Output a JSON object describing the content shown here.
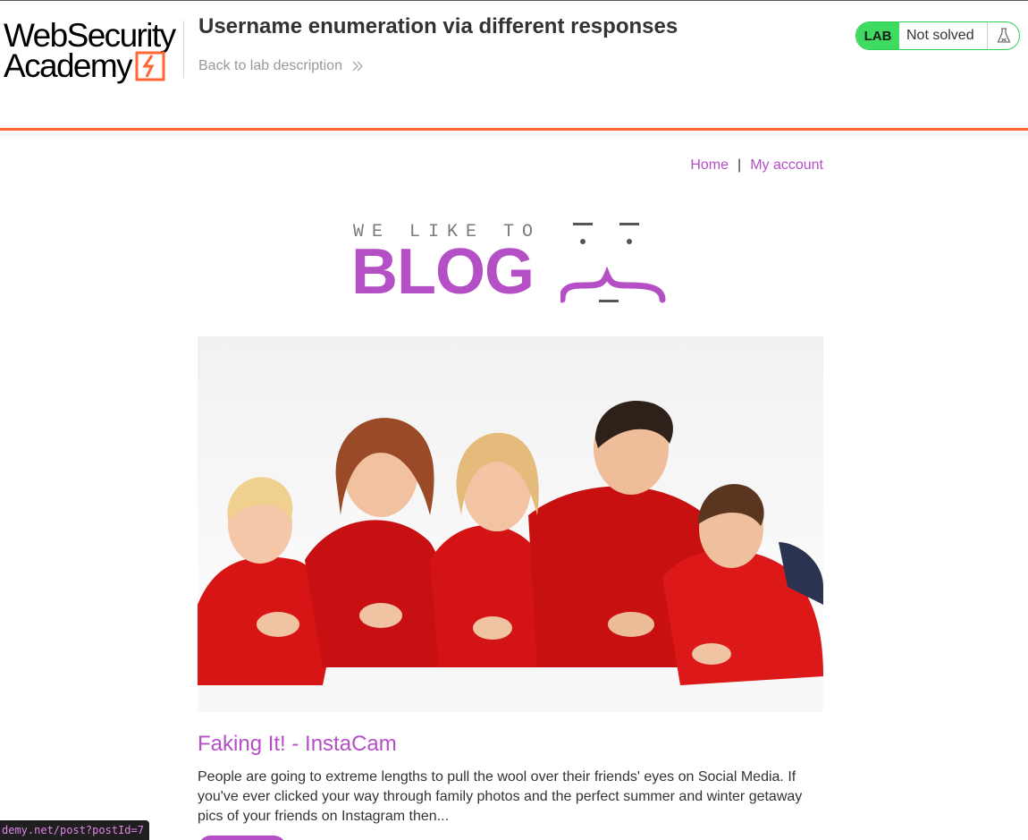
{
  "academy": {
    "logo_line1": "WebSecurity",
    "logo_line2": "Academy",
    "lab_title": "Username enumeration via different responses",
    "back_link": "Back to lab description",
    "status_badge": "LAB",
    "status_text": "Not solved",
    "status_icon": "flask-icon",
    "colors": {
      "accent": "#ff6633",
      "status_green": "#3ddc60"
    }
  },
  "nav": {
    "home": "Home",
    "separator": "|",
    "my_account": "My account"
  },
  "banner": {
    "small_text": "WE LIKE TO",
    "big_text": "BLOG",
    "brand_color": "#b44fc5"
  },
  "post": {
    "image_alt": "family in red sweaters lying on the floor",
    "title": "Faking It! - InstaCam",
    "summary": "People are going to extreme lengths to pull the wool over their friends' eyes on Social Media. If you've ever clicked your way through family photos and the perfect summer and winter getaway pics of your friends on Instagram then..."
  },
  "statusbar": {
    "url": "demy.net/post?postId=7"
  }
}
